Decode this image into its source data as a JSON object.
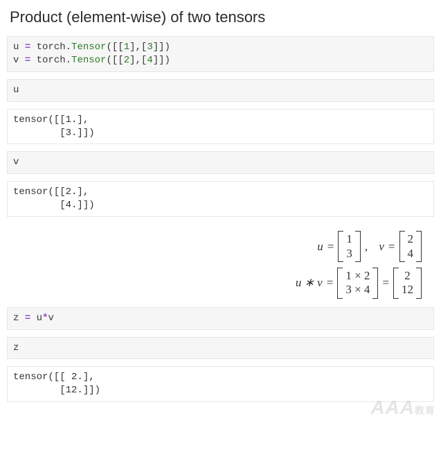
{
  "title": "Product (element-wise) of two tensors",
  "cells": {
    "c1": {
      "u_def": {
        "lhs": "u",
        "eq": "=",
        "mod": "torch",
        "dot": ".",
        "call": "Tensor",
        "args": "([[1],[3]])",
        "n1": "1",
        "n2": "3"
      },
      "v_def": {
        "lhs": "v",
        "eq": "=",
        "mod": "torch",
        "dot": ".",
        "call": "Tensor",
        "args": "([[2],[4]])",
        "n1": "2",
        "n2": "4"
      }
    },
    "c2": {
      "expr": "u"
    },
    "c2_out": "tensor([[1.],\n        [3.]])",
    "c3": {
      "expr": "v"
    },
    "c3_out": "tensor([[2.],\n        [4.]])",
    "c4": {
      "lhs": "z",
      "eq": "=",
      "rhs_a": "u",
      "star": "*",
      "rhs_b": "v"
    },
    "c5": {
      "expr": "z"
    },
    "c5_out": "tensor([[ 2.],\n        [12.]])"
  },
  "math": {
    "eq1": {
      "u": "u",
      "eq_a": "=",
      "u_r1": "1",
      "u_r2": "3",
      "comma": ",",
      "v": "v",
      "eq_b": "=",
      "v_r1": "2",
      "v_r2": "4"
    },
    "eq2": {
      "lhs": "u ∗ v",
      "eq_a": "=",
      "m_r1": "1 × 2",
      "m_r2": "3 × 4",
      "eq_b": "=",
      "r_r1": "2",
      "r_r2": "12"
    }
  },
  "watermark": {
    "big": "AAA",
    "small": "教育"
  }
}
